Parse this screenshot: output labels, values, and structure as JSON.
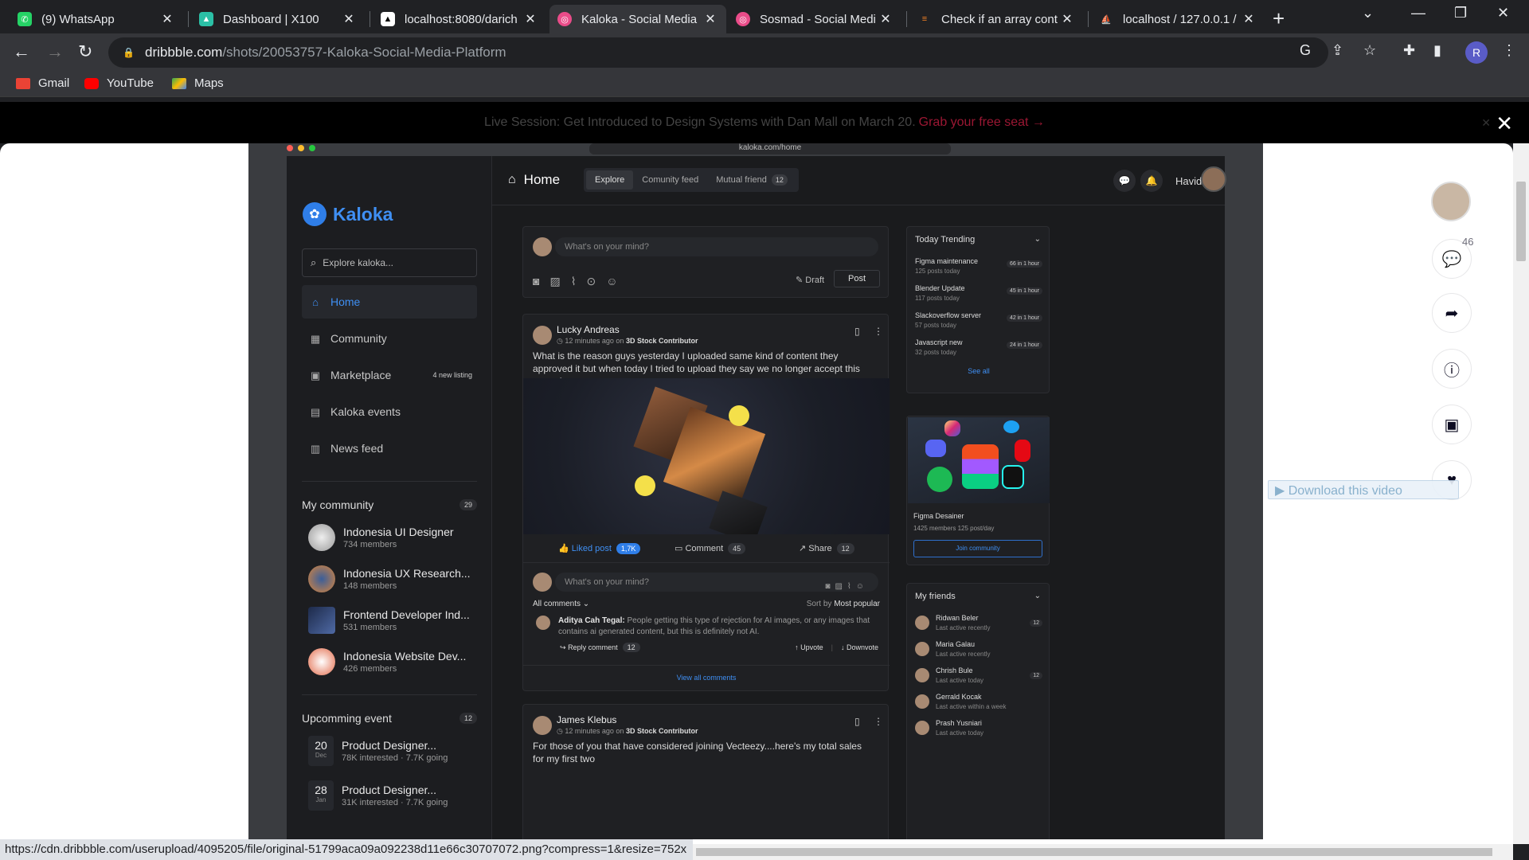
{
  "browser": {
    "tabs": [
      {
        "title": "(9) WhatsApp",
        "favicon_color": "#25d366"
      },
      {
        "title": "Dashboard | X100",
        "favicon_color": "#2bc0a6"
      },
      {
        "title": "localhost:8080/darich",
        "favicon_color": "#000000"
      },
      {
        "title": "Kaloka - Social Media",
        "favicon_color": "#ea4c89"
      },
      {
        "title": "Sosmad - Social Medi",
        "favicon_color": "#ea4c89"
      },
      {
        "title": "Check if an array cont",
        "favicon_color": "#f48024"
      },
      {
        "title": "localhost / 127.0.0.1 /",
        "favicon_color": "#f29111"
      }
    ],
    "active_tab": 3,
    "url_domain": "dribbble.com",
    "url_path": "/shots/20053757-Kaloka-Social-Media-Platform",
    "profile_initial": "R",
    "bookmarks": [
      "Gmail",
      "YouTube",
      "Maps"
    ],
    "status_url": "https://cdn.dribbble.com/userupload/4095205/file/original-51799aca09a092238d11e66c30707072.png?compress=1&resize=752x"
  },
  "banner": {
    "text": "Live Session: Get Introduced to Design Systems with Dan Mall on March 20.",
    "link": "Grab your free seat →"
  },
  "shot": {
    "mac_url": "kaloka.com/home",
    "brand": "Kaloka",
    "search_placeholder": "Explore kaloka...",
    "nav": [
      {
        "label": "Home",
        "icon": "home-icon",
        "active": true
      },
      {
        "label": "Community",
        "icon": "community-icon"
      },
      {
        "label": "Marketplace",
        "icon": "marketplace-icon",
        "badge": "4 new listing"
      },
      {
        "label": "Kaloka events",
        "icon": "calendar-icon"
      },
      {
        "label": "News feed",
        "icon": "news-icon"
      }
    ],
    "my_community": {
      "title": "My community",
      "count": "29",
      "items": [
        {
          "name": "Indonesia UI Designer",
          "members": "734 members"
        },
        {
          "name": "Indonesia UX Research...",
          "members": "148 members"
        },
        {
          "name": "Frontend Developer Ind...",
          "members": "531 members"
        },
        {
          "name": "Indonesia Website Dev...",
          "members": "426 members"
        }
      ]
    },
    "events": {
      "title": "Upcomming event",
      "count": "12",
      "items": [
        {
          "day": "20",
          "month": "Dec",
          "name": "Product Designer...",
          "sub": "78K interested · 7.7K going"
        },
        {
          "day": "28",
          "month": "Jan",
          "name": "Product Designer...",
          "sub": "31K interested · 7.7K going"
        }
      ]
    },
    "topbar": {
      "title": "Home",
      "tabs": [
        "Explore",
        "Comunity feed",
        "Mutual friend"
      ],
      "mutual_count": "12",
      "user": "Havid N"
    },
    "composer": {
      "placeholder": "What's on your mind?",
      "draft": "Draft",
      "post": "Post"
    },
    "post1": {
      "author": "Lucky Andreas",
      "time": "12 minutes ago on",
      "source": "3D Stock Contributor",
      "text": "What is the reason guys yesterday I uploaded same kind of content they approved it but when today I tried to upload they say we no longer accept this type of content",
      "liked": "Liked post",
      "likes": "1,7K",
      "comment": "Comment",
      "comments": "45",
      "share": "Share",
      "shares": "12",
      "reply_placeholder": "What's on your mind?",
      "all_comments": "All comments",
      "sort_by": "Sort by",
      "sort_value": "Most popular",
      "comment_author": "Aditya Cah Tegal:",
      "comment_text": "People getting this type of rejection for AI images, or any images that contains ai generated content, but this is definitely not AI.",
      "reply_label": "Reply comment",
      "reply_count": "12",
      "upvote": "Upvote",
      "downvote": "Downvote",
      "view_all": "View all comments"
    },
    "post2": {
      "author": "James Klebus",
      "time": "12 minutes ago on",
      "source": "3D Stock Contributor",
      "text": "For those of you that have considered joining Vecteezy....here's my total sales for my first two"
    },
    "trending": {
      "title": "Today Trending",
      "items": [
        {
          "name": "Figma maintenance",
          "posts": "125 posts today",
          "badge": "66 in 1 hour"
        },
        {
          "name": "Blender Update",
          "posts": "117 posts today",
          "badge": "45 in 1 hour"
        },
        {
          "name": "Slackoverflow server",
          "posts": "57 posts today",
          "badge": "42 in 1 hour"
        },
        {
          "name": "Javascript new",
          "posts": "32 posts today",
          "badge": "24 in 1 hour"
        }
      ],
      "see_all": "See all"
    },
    "featured": {
      "name": "Figma Desainer",
      "stats": "1425 members    125 post/day",
      "join": "Join community"
    },
    "friends": {
      "title": "My friends",
      "items": [
        {
          "name": "Ridwan Beler",
          "status": "Last active recently",
          "badge": "12"
        },
        {
          "name": "Maria Galau",
          "status": "Last active recently",
          "badge": ""
        },
        {
          "name": "Chrish Bule",
          "status": "Last active today",
          "badge": "12"
        },
        {
          "name": "Gerrald Kocak",
          "status": "Last active within a week",
          "badge": ""
        },
        {
          "name": "Prash Yusniari",
          "status": "Last active today",
          "badge": ""
        }
      ]
    }
  },
  "rail": {
    "comment_count": "46",
    "download_label": "▶ Download this video"
  }
}
